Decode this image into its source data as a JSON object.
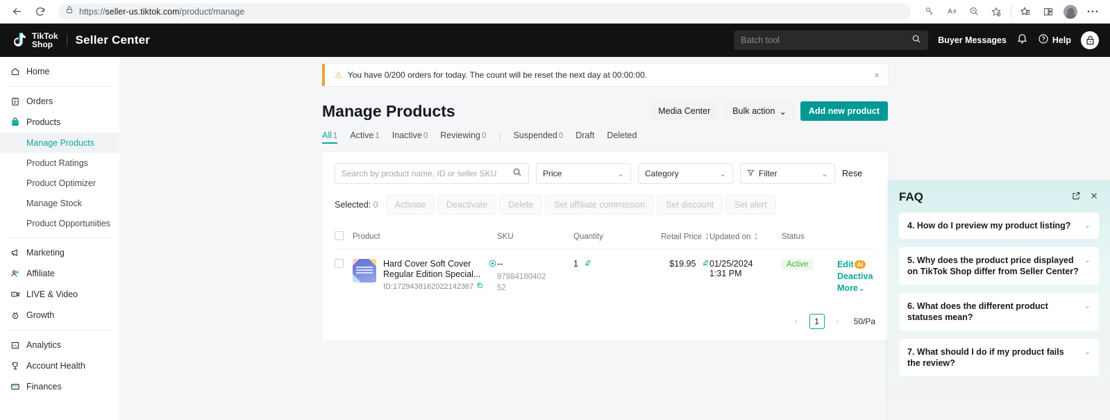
{
  "browser": {
    "url_prefix": "https://",
    "url_domain": "seller-us.tiktok.com",
    "url_path": "/product/manage",
    "back_icon": "back-arrow-icon",
    "reload_icon": "reload-icon",
    "lock_icon": "site-info-lock-icon",
    "icons": [
      "key-icon",
      "read-aloud-icon",
      "zoom-out-icon",
      "add-favorite-icon",
      "collections-icon",
      "split-screen-icon",
      "profile-icon",
      "settings-more-icon"
    ]
  },
  "topbar": {
    "logo_line1": "TikTok",
    "logo_line2": "Shop",
    "app_name": "Seller Center",
    "search_placeholder": "Batch tool",
    "buyer_messages": "Buyer Messages",
    "help": "Help",
    "notification_icon": "bell-icon",
    "help_icon": "help-circle-icon",
    "shop_icon": "shop-avatar-icon"
  },
  "sidebar": {
    "items": [
      {
        "label": "Home",
        "icon": "home-icon"
      },
      {
        "label": "Orders",
        "icon": "orders-clipboard-icon"
      },
      {
        "label": "Products",
        "icon": "products-bag-icon"
      },
      {
        "label": "Marketing",
        "icon": "marketing-megaphone-icon"
      },
      {
        "label": "Affiliate",
        "icon": "affiliate-people-icon"
      },
      {
        "label": "LIVE & Video",
        "icon": "live-video-icon"
      },
      {
        "label": "Growth",
        "icon": "growth-medal-icon"
      },
      {
        "label": "Analytics",
        "icon": "analytics-chart-icon"
      },
      {
        "label": "Account Health",
        "icon": "account-health-trophy-icon"
      },
      {
        "label": "Finances",
        "icon": "finances-card-icon"
      }
    ],
    "products_sub": [
      {
        "label": "Manage Products",
        "active": true
      },
      {
        "label": "Product Ratings",
        "active": false
      },
      {
        "label": "Product Optimizer",
        "active": false
      },
      {
        "label": "Manage Stock",
        "active": false
      },
      {
        "label": "Product Opportunities",
        "active": false
      }
    ]
  },
  "alert": {
    "text": "You have 0/200 orders for today. The count will be reset the next day at 00:00:00.",
    "warning_icon": "warning-triangle-icon",
    "close_icon": "close-icon"
  },
  "page": {
    "title": "Manage Products",
    "media_center": "Media Center",
    "bulk_action": "Bulk action",
    "add_new_product": "Add new product"
  },
  "tabs": [
    {
      "label": "All",
      "count": "1",
      "active": true
    },
    {
      "label": "Active",
      "count": "1",
      "active": false
    },
    {
      "label": "Inactive",
      "count": "0",
      "active": false
    },
    {
      "label": "Reviewing",
      "count": "0",
      "active": false
    },
    {
      "label": "Suspended",
      "count": "0",
      "active": false
    },
    {
      "label": "Draft",
      "count": "",
      "active": false
    },
    {
      "label": "Deleted",
      "count": "",
      "active": false
    }
  ],
  "filters": {
    "search_placeholder": "Search by product name, ID or seller SKU",
    "search_value": "",
    "price": "Price",
    "category": "Category",
    "filter": "Filter",
    "reset": "Rese",
    "search_icon": "search-icon",
    "filter_icon": "funnel-icon"
  },
  "bulk": {
    "selected_label": "Selected:",
    "selected_count": "0",
    "buttons": [
      "Activate",
      "Deactivate",
      "Delete",
      "Set affiliate commission",
      "Set discount",
      "Set alert"
    ]
  },
  "table": {
    "columns": [
      "Product",
      "SKU",
      "Quantity",
      "Retail Price",
      "Updated on",
      "Status"
    ],
    "rows": [
      {
        "name": "Hard Cover Soft Cover Regular Edition Special...",
        "id_label": "ID:1729438162022142367",
        "sku_dash": "--",
        "sku_code": "9788418040252",
        "quantity": "1",
        "retail_price": "$19.95",
        "updated_date": "01/25/2024",
        "updated_time": "1:31 PM",
        "status": "Active",
        "actions": [
          "Edit",
          "Deactiva",
          "More"
        ],
        "ai_badge": "AI",
        "preview_icon": "preview-eye-icon",
        "copy_icon": "copy-icon",
        "edit_icon": "edit-pencil-icon"
      }
    ]
  },
  "pagination": {
    "prev_icon": "chevron-left-icon",
    "next_icon": "chevron-right-icon",
    "current_page": "1",
    "page_size": "50/Pa"
  },
  "faq": {
    "title": "FAQ",
    "open_icon": "open-in-new-icon",
    "close_icon": "close-icon",
    "items": [
      {
        "question": "4. How do I preview my product listing?"
      },
      {
        "question": "5. Why does the product price displayed on TikTok Shop differ from Seller Center?"
      },
      {
        "question": "6. What does the different product statuses mean?"
      },
      {
        "question": "7. What should I do if my product fails the review?"
      }
    ]
  },
  "colors": {
    "brand_teal": "#0aa89a",
    "primary_button": "#009995",
    "warning": "#e8a33d",
    "status_active": "#3fae3f",
    "ai_badge": "#f5a524"
  }
}
